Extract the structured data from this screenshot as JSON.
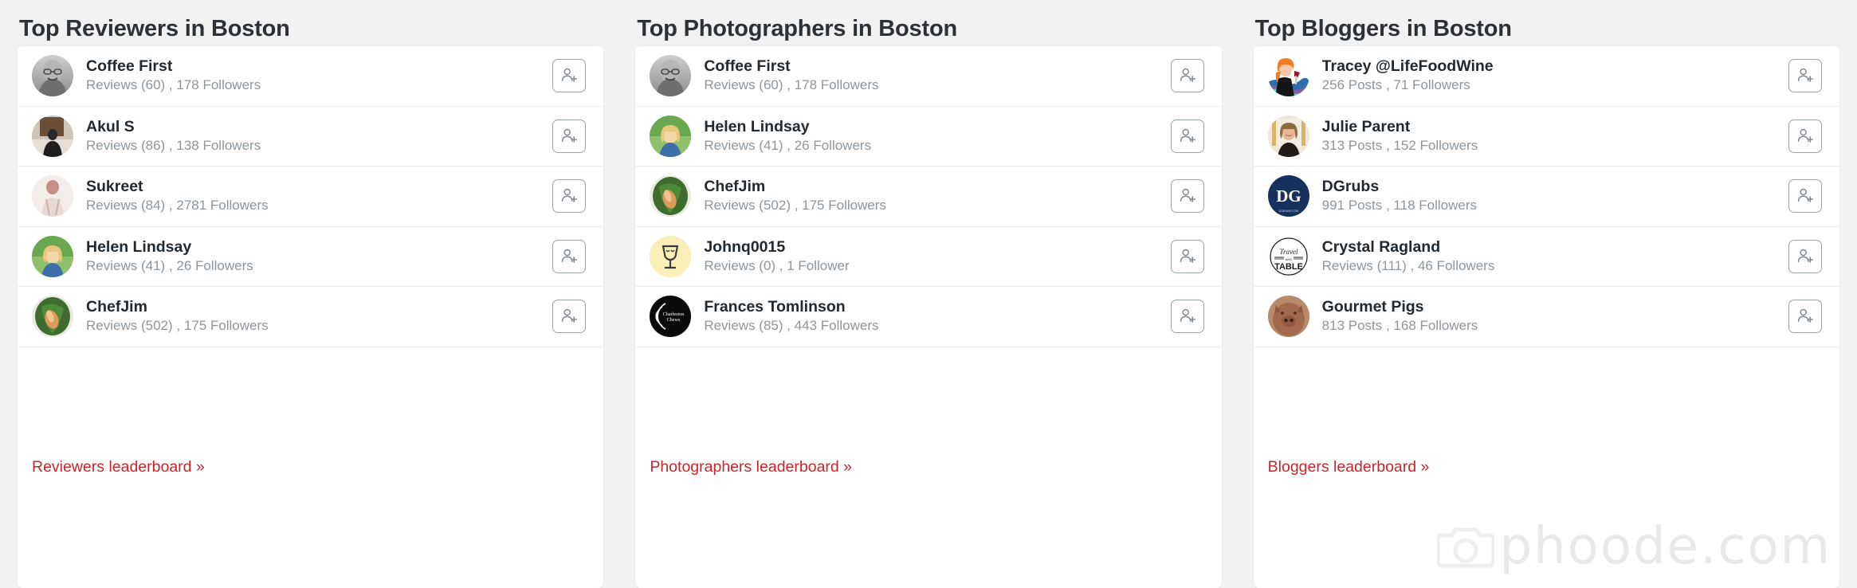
{
  "watermark": {
    "text": "phoode.com",
    "icon": "camera-icon"
  },
  "theme": {
    "page_background": "#f2f2f2",
    "card_background": "#ffffff",
    "title_color": "#2b3137",
    "meta_color": "#8e969c",
    "link_color": "#c8262b",
    "button_border": "#9aa3aa"
  },
  "columns": [
    {
      "id": "reviewers",
      "title": "Top Reviewers in Boston",
      "footer_link": "Reviewers leaderboard »",
      "people": [
        {
          "name": "Coffee First",
          "meta": "Reviews (60) , 178 Followers",
          "avatar": "photo-woman-glasses-bw",
          "follow_label": "add-user-icon"
        },
        {
          "name": "Akul S",
          "meta": "Reviews (86) , 138 Followers",
          "avatar": "photo-person-indoor",
          "follow_label": "add-user-icon"
        },
        {
          "name": "Sukreet",
          "meta": "Reviews (84) , 2781 Followers",
          "avatar": "photo-person-pale",
          "follow_label": "add-user-icon"
        },
        {
          "name": "Helen Lindsay",
          "meta": "Reviews (41) , 26 Followers",
          "avatar": "photo-woman-blonde-grass",
          "follow_label": "add-user-icon"
        },
        {
          "name": "ChefJim",
          "meta": "Reviews (502) , 175 Followers",
          "avatar": "photo-food-wrap",
          "follow_label": "add-user-icon"
        }
      ]
    },
    {
      "id": "photographers",
      "title": "Top Photographers in Boston",
      "footer_link": "Photographers leaderboard »",
      "people": [
        {
          "name": "Coffee First",
          "meta": "Reviews (60) , 178 Followers",
          "avatar": "photo-woman-glasses-bw",
          "follow_label": "add-user-icon"
        },
        {
          "name": "Helen Lindsay",
          "meta": "Reviews (41) , 26 Followers",
          "avatar": "photo-woman-blonde-grass",
          "follow_label": "add-user-icon"
        },
        {
          "name": "ChefJim",
          "meta": "Reviews (502) , 175 Followers",
          "avatar": "photo-food-wrap",
          "follow_label": "add-user-icon"
        },
        {
          "name": "Johnq0015",
          "meta": "Reviews (0) , 1 Follower",
          "avatar": "wine-glass-yellow",
          "follow_label": "add-user-icon"
        },
        {
          "name": "Frances Tomlinson",
          "meta": "Reviews (85) , 443 Followers",
          "avatar": "logo-charleston-chews",
          "follow_label": "add-user-icon"
        }
      ]
    },
    {
      "id": "bloggers",
      "title": "Top Bloggers in Boston",
      "footer_link": "Bloggers leaderboard »",
      "people": [
        {
          "name": "Tracey @LifeFoodWine",
          "meta": "256 Posts , 71 Followers",
          "avatar": "illustration-woman-wine",
          "follow_label": "add-user-icon"
        },
        {
          "name": "Julie Parent",
          "meta": "313 Posts , 152 Followers",
          "avatar": "photo-woman-smiling",
          "follow_label": "add-user-icon"
        },
        {
          "name": "DGrubs",
          "meta": "991 Posts , 118 Followers",
          "avatar": "logo-dg-navy",
          "follow_label": "add-user-icon"
        },
        {
          "name": "Crystal Ragland",
          "meta": "Reviews (111) , 46 Followers",
          "avatar": "logo-travel-table",
          "follow_label": "add-user-icon"
        },
        {
          "name": "Gourmet Pigs",
          "meta": "813 Posts , 168 Followers",
          "avatar": "photo-pig-figure",
          "follow_label": "add-user-icon"
        }
      ]
    }
  ]
}
